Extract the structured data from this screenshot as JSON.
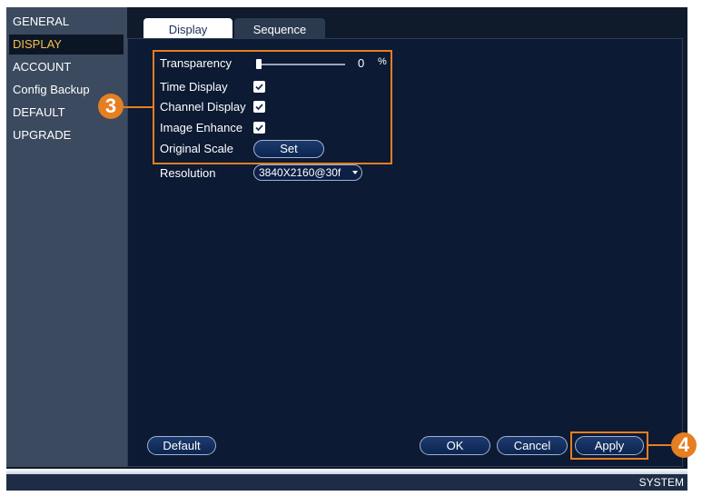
{
  "sidebar": {
    "items": [
      {
        "label": "GENERAL"
      },
      {
        "label": "DISPLAY",
        "active": true
      },
      {
        "label": "ACCOUNT"
      },
      {
        "label": "Config Backup"
      },
      {
        "label": "DEFAULT"
      },
      {
        "label": "UPGRADE"
      }
    ]
  },
  "tabs": [
    {
      "label": "Display",
      "active": true
    },
    {
      "label": "Sequence"
    }
  ],
  "settings": {
    "transparency": {
      "label": "Transparency",
      "value": "0",
      "unit": "%",
      "slider_fraction": 0
    },
    "time_display": {
      "label": "Time Display",
      "checked": true
    },
    "channel_display": {
      "label": "Channel Display",
      "checked": true
    },
    "image_enhance": {
      "label": "Image Enhance",
      "checked": true
    },
    "original_scale": {
      "label": "Original Scale",
      "button": "Set"
    },
    "resolution": {
      "label": "Resolution",
      "value": "3840X2160@30f"
    }
  },
  "buttons": {
    "default": "Default",
    "ok": "OK",
    "cancel": "Cancel",
    "apply": "Apply"
  },
  "callouts": {
    "settings": "3",
    "apply": "4"
  },
  "footer": {
    "label": "SYSTEM"
  },
  "colors": {
    "accent_orange": "#e67e22",
    "active_text": "#f4c04a",
    "panel_bg": "#0c1a33",
    "sidebar_bg": "#3b4a5e"
  }
}
